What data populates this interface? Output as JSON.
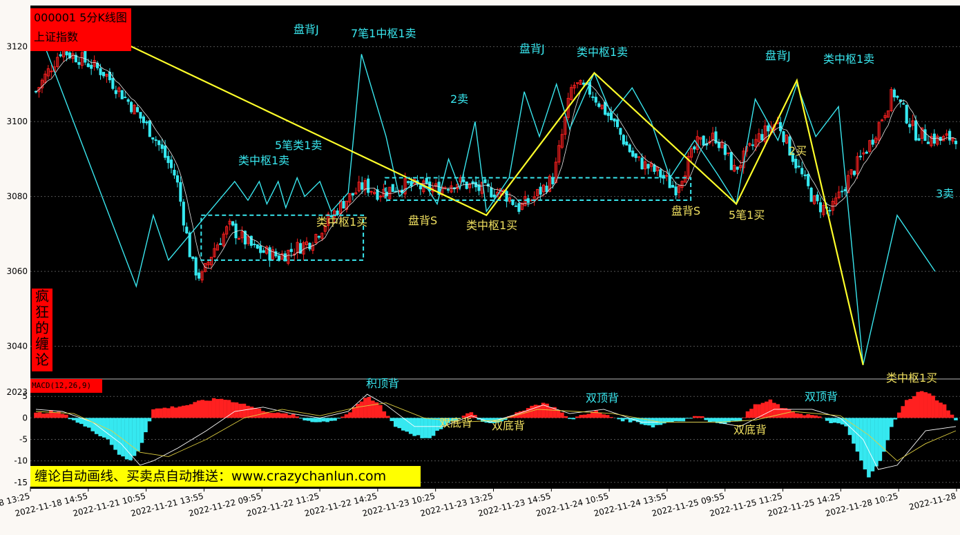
{
  "header": {
    "code_line": "000001 5分K线图",
    "name_line": "上证指数"
  },
  "side_label": [
    "疯",
    "狂",
    "的",
    "缠",
    "论"
  ],
  "macd_label": "MACD(12,26,9)",
  "footer": "缠论自动画线、买卖点自动推送：www.crazychanlun.com",
  "colors": {
    "background": "#000000",
    "page": "#fbf8f4",
    "up_candle": "#ff2020",
    "down_candle": "#35e8f0",
    "stroke_line": "#39e6ee",
    "segment_line": "#ffff2a",
    "label_sell": "#39e6ee",
    "label_buy": "#f0e060",
    "ma_line": "#e8e8e8",
    "dea_line": "#e0d040"
  },
  "chart_data": {
    "type": "candlestick",
    "price_axis": {
      "ylim": [
        3032,
        3131
      ],
      "ticks": [
        3040,
        3060,
        3080,
        3100,
        3120
      ]
    },
    "macd_axis": {
      "ylim": [
        -16,
        6
      ],
      "ticks": [
        5,
        0,
        -5,
        -10,
        -15
      ],
      "top_label": "2023"
    },
    "x_ticks": [
      "2022-11-18 13:25",
      "2022-11-18 14:55",
      "2022-11-21 10:55",
      "2022-11-21 13:55",
      "2022-11-22 09:55",
      "2022-11-22 11:25",
      "2022-11-22 14:25",
      "2022-11-23 10:25",
      "2022-11-23 13:25",
      "2022-11-23 14:55",
      "2022-11-24 10:55",
      "2022-11-24 13:55",
      "2022-11-25 09:55",
      "2022-11-25 11:25",
      "2022-11-25 14:25",
      "2022-11-28 10:25",
      "2022-11-28"
    ],
    "bar_count": 300,
    "price_path": [
      [
        0,
        3108
      ],
      [
        8,
        3119
      ],
      [
        14,
        3117
      ],
      [
        22,
        3113
      ],
      [
        30,
        3105
      ],
      [
        38,
        3096
      ],
      [
        45,
        3085
      ],
      [
        50,
        3062
      ],
      [
        53,
        3058
      ],
      [
        57,
        3066
      ],
      [
        62,
        3072
      ],
      [
        70,
        3066
      ],
      [
        78,
        3064
      ],
      [
        88,
        3068
      ],
      [
        98,
        3078
      ],
      [
        105,
        3083
      ],
      [
        110,
        3081
      ],
      [
        118,
        3083
      ],
      [
        128,
        3082
      ],
      [
        135,
        3084
      ],
      [
        142,
        3082
      ],
      [
        150,
        3081
      ],
      [
        155,
        3077
      ],
      [
        160,
        3080
      ],
      [
        166,
        3085
      ],
      [
        172,
        3110
      ],
      [
        178,
        3108
      ],
      [
        185,
        3100
      ],
      [
        192,
        3090
      ],
      [
        200,
        3086
      ],
      [
        205,
        3082
      ],
      [
        212,
        3094
      ],
      [
        218,
        3096
      ],
      [
        224,
        3087
      ],
      [
        232,
        3096
      ],
      [
        238,
        3100
      ],
      [
        243,
        3090
      ],
      [
        250,
        3078
      ],
      [
        255,
        3076
      ],
      [
        260,
        3084
      ],
      [
        268,
        3095
      ],
      [
        275,
        3108
      ],
      [
        282,
        3097
      ],
      [
        290,
        3095
      ],
      [
        295,
        3096
      ]
    ],
    "strokes": [
      [
        4,
        3121
      ],
      [
        53,
        3056
      ],
      [
        62,
        3075
      ],
      [
        70,
        3063
      ],
      [
        105,
        3084
      ],
      [
        112,
        3079
      ],
      [
        118,
        3084
      ],
      [
        122,
        3078
      ],
      [
        128,
        3084
      ],
      [
        132,
        3077
      ],
      [
        138,
        3085
      ],
      [
        142,
        3080
      ],
      [
        150,
        3084
      ],
      [
        156,
        3076
      ],
      [
        165,
        3081
      ],
      [
        172,
        3118
      ],
      [
        185,
        3096
      ],
      [
        192,
        3080
      ],
      [
        200,
        3084
      ],
      [
        207,
        3082
      ],
      [
        212,
        3078
      ],
      [
        218,
        3090
      ],
      [
        224,
        3082
      ],
      [
        232,
        3100
      ],
      [
        238,
        3076
      ],
      [
        250,
        3085
      ],
      [
        258,
        3108
      ],
      [
        266,
        3096
      ],
      [
        275,
        3110
      ],
      [
        282,
        3098
      ],
      [
        295,
        3113
      ],
      [
        304,
        3102
      ],
      [
        315,
        3109
      ],
      [
        325,
        3100
      ],
      [
        335,
        3085
      ],
      [
        348,
        3095
      ],
      [
        360,
        3086
      ],
      [
        370,
        3078
      ],
      [
        380,
        3106
      ],
      [
        392,
        3095
      ],
      [
        402,
        3110
      ],
      [
        412,
        3096
      ],
      [
        424,
        3104
      ],
      [
        437,
        3035
      ],
      [
        455,
        3075
      ],
      [
        475,
        3060
      ]
    ],
    "segments": [
      [
        34,
        3124
      ],
      [
        238,
        3075
      ],
      [
        295,
        3113
      ],
      [
        370,
        3078
      ],
      [
        402,
        3111
      ],
      [
        437,
        3035
      ]
    ],
    "pivots": [
      {
        "x0": 53,
        "x1": 105,
        "y0": 3063,
        "y1": 3075
      },
      {
        "x0": 112,
        "x1": 210,
        "y0": 3079,
        "y1": 3085
      },
      {
        "x0": 345,
        "x1": 372,
        "y0": 3086,
        "y1": 3090
      }
    ],
    "macd_hist": [
      [
        0,
        1
      ],
      [
        8,
        1.5
      ],
      [
        14,
        1
      ],
      [
        22,
        -1
      ],
      [
        30,
        -3
      ],
      [
        38,
        -5
      ],
      [
        45,
        -9
      ],
      [
        50,
        -10
      ],
      [
        55,
        -7
      ],
      [
        62,
        2
      ],
      [
        72,
        2.5
      ],
      [
        80,
        3
      ],
      [
        88,
        4
      ],
      [
        98,
        4.5
      ],
      [
        108,
        3.5
      ],
      [
        118,
        2
      ],
      [
        128,
        1
      ],
      [
        135,
        0.8
      ],
      [
        142,
        -0.5
      ],
      [
        150,
        -1
      ],
      [
        158,
        -0.5
      ],
      [
        165,
        1
      ],
      [
        170,
        3
      ],
      [
        175,
        5
      ],
      [
        182,
        3
      ],
      [
        190,
        -2
      ],
      [
        200,
        -4
      ],
      [
        208,
        -5
      ],
      [
        215,
        -2
      ],
      [
        222,
        -0.5
      ],
      [
        230,
        1.5
      ],
      [
        236,
        -1
      ],
      [
        244,
        -1
      ],
      [
        252,
        0.5
      ],
      [
        260,
        2.5
      ],
      [
        268,
        3.5
      ],
      [
        276,
        2
      ],
      [
        282,
        -0.5
      ],
      [
        290,
        1
      ],
      [
        296,
        1.5
      ],
      [
        302,
        0.5
      ],
      [
        310,
        -0.5
      ],
      [
        318,
        -1
      ],
      [
        326,
        -2
      ],
      [
        334,
        -1
      ],
      [
        342,
        -0.5
      ],
      [
        350,
        0.5
      ],
      [
        358,
        -1
      ],
      [
        366,
        -1.2
      ],
      [
        372,
        -0.5
      ],
      [
        380,
        3
      ],
      [
        388,
        4
      ],
      [
        396,
        2
      ],
      [
        404,
        1
      ],
      [
        412,
        0.5
      ],
      [
        420,
        -1
      ],
      [
        428,
        -2
      ],
      [
        434,
        -8
      ],
      [
        440,
        -14
      ],
      [
        447,
        -9
      ],
      [
        453,
        -1
      ],
      [
        460,
        4
      ],
      [
        468,
        6.5
      ],
      [
        474,
        5
      ],
      [
        480,
        3
      ],
      [
        486,
        -0.5
      ]
    ],
    "dif_path": [
      [
        0,
        2
      ],
      [
        14,
        1.5
      ],
      [
        30,
        -1
      ],
      [
        45,
        -6
      ],
      [
        55,
        -11
      ],
      [
        62,
        -10
      ],
      [
        75,
        -7
      ],
      [
        90,
        -3
      ],
      [
        105,
        1.5
      ],
      [
        120,
        2.5
      ],
      [
        135,
        1
      ],
      [
        150,
        0
      ],
      [
        165,
        1.5
      ],
      [
        175,
        5.5
      ],
      [
        185,
        3
      ],
      [
        200,
        -2
      ],
      [
        215,
        -2
      ],
      [
        230,
        0.5
      ],
      [
        240,
        -1
      ],
      [
        255,
        1
      ],
      [
        268,
        3
      ],
      [
        282,
        1
      ],
      [
        300,
        2
      ],
      [
        320,
        -1
      ],
      [
        340,
        -1
      ],
      [
        360,
        -1
      ],
      [
        372,
        -2
      ],
      [
        390,
        2
      ],
      [
        410,
        2
      ],
      [
        425,
        0
      ],
      [
        437,
        -5
      ],
      [
        445,
        -12
      ],
      [
        455,
        -11
      ],
      [
        470,
        -3
      ],
      [
        486,
        -2
      ]
    ],
    "dea_path": [
      [
        0,
        1.5
      ],
      [
        20,
        1
      ],
      [
        40,
        -3
      ],
      [
        55,
        -8
      ],
      [
        70,
        -9
      ],
      [
        90,
        -5
      ],
      [
        110,
        0
      ],
      [
        130,
        2
      ],
      [
        150,
        0.5
      ],
      [
        170,
        2.5
      ],
      [
        185,
        3.5
      ],
      [
        205,
        0
      ],
      [
        225,
        -1
      ],
      [
        245,
        -0.5
      ],
      [
        265,
        2
      ],
      [
        285,
        1.5
      ],
      [
        305,
        1
      ],
      [
        330,
        -1
      ],
      [
        360,
        -1
      ],
      [
        380,
        -0.5
      ],
      [
        400,
        1.5
      ],
      [
        425,
        0.5
      ],
      [
        440,
        -4
      ],
      [
        455,
        -10
      ],
      [
        470,
        -6
      ],
      [
        486,
        -3
      ]
    ],
    "annotations": [
      {
        "text": "盘背J",
        "color": "sell",
        "x": 425,
        "y": 48
      },
      {
        "text": "7笔1中枢1卖",
        "color": "sell",
        "x": 508,
        "y": 54
      },
      {
        "text": "盘背J",
        "color": "sell",
        "x": 752,
        "y": 76
      },
      {
        "text": "类中枢1卖",
        "color": "sell",
        "x": 835,
        "y": 81
      },
      {
        "text": "盘背J",
        "color": "sell",
        "x": 1108,
        "y": 86
      },
      {
        "text": "类中枢1卖",
        "color": "sell",
        "x": 1192,
        "y": 91
      },
      {
        "text": "2卖",
        "color": "sell",
        "x": 652,
        "y": 149
      },
      {
        "text": "5笔类1卖",
        "color": "sell",
        "x": 398,
        "y": 216
      },
      {
        "text": "类中枢1卖",
        "color": "sell",
        "x": 345,
        "y": 238
      },
      {
        "text": "3卖",
        "color": "sell",
        "x": 1355,
        "y": 286
      },
      {
        "text": "2买",
        "color": "buy",
        "x": 1142,
        "y": 224
      },
      {
        "text": "类中枢1买",
        "color": "buy",
        "x": 458,
        "y": 327
      },
      {
        "text": "盘背S",
        "color": "buy",
        "x": 591,
        "y": 325
      },
      {
        "text": "类中枢1买",
        "color": "buy",
        "x": 675,
        "y": 332
      },
      {
        "text": "盘背S",
        "color": "buy",
        "x": 972,
        "y": 311
      },
      {
        "text": "5笔1买",
        "color": "buy",
        "x": 1055,
        "y": 317
      },
      {
        "text": "类中枢1买",
        "color": "buy",
        "x": 1283,
        "y": 553
      },
      {
        "text": "积顶背",
        "color": "sell",
        "x": 530,
        "y": 561
      },
      {
        "text": "双顶背",
        "color": "sell",
        "x": 848,
        "y": 582
      },
      {
        "text": "双顶背",
        "color": "sell",
        "x": 1165,
        "y": 580
      },
      {
        "text": "双底背",
        "color": "buy",
        "x": 636,
        "y": 618
      },
      {
        "text": "双底背",
        "color": "buy",
        "x": 712,
        "y": 622
      },
      {
        "text": "双底背",
        "color": "buy",
        "x": 1062,
        "y": 628
      }
    ]
  }
}
